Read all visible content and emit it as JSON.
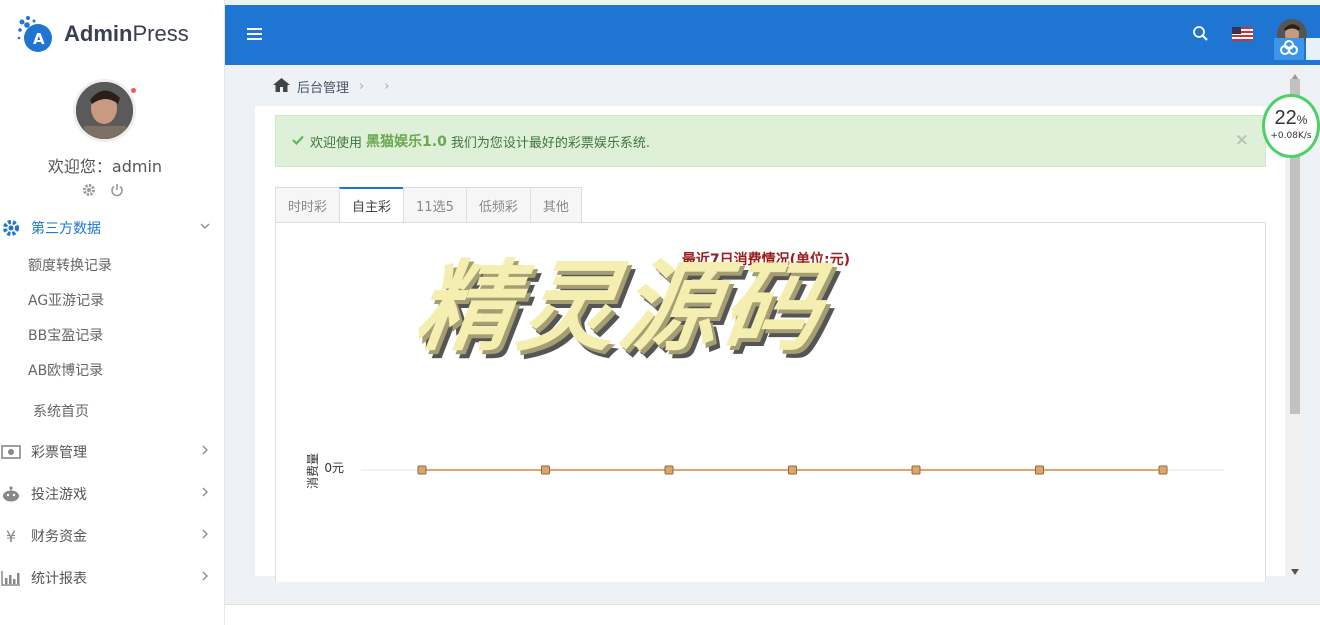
{
  "brand": {
    "name_bold": "Admin",
    "name_rest": "Press"
  },
  "user": {
    "welcome": "欢迎您：admin"
  },
  "sidebar": {
    "group_thirdparty": {
      "label": "第三方数据",
      "items": [
        "额度转换记录",
        "AG亚游记录",
        "BB宝盈记录",
        "AB欧博记录"
      ]
    },
    "home_label": "系统首页",
    "menus": [
      "彩票管理",
      "投注游戏",
      "财务资金",
      "统计报表"
    ]
  },
  "breadcrumb": {
    "home": "后台管理"
  },
  "alert": {
    "prefix": "欢迎使用",
    "brand": "黑猫娱乐1.0",
    "suffix": "我们为您设计最好的彩票娱乐系统.",
    "close": "×"
  },
  "tabs": [
    "时时彩",
    "自主彩",
    "11选5",
    "低频彩",
    "其他"
  ],
  "active_tab": 1,
  "chart_data": {
    "type": "line",
    "title": "最近7日消费情况(单位:元)",
    "ylabel": "消费量",
    "y_tick": "0元",
    "values": [
      0,
      0,
      0,
      0,
      0,
      0,
      0
    ],
    "color": "#e8a36a"
  },
  "watermark": "精灵源码",
  "speed": {
    "percent": "22",
    "unit": "%",
    "rate": "+0.08K/s"
  },
  "colors": {
    "topbar": "#1e76d2",
    "accent": "#1e76d2",
    "alert_bg": "#dff0d8"
  }
}
